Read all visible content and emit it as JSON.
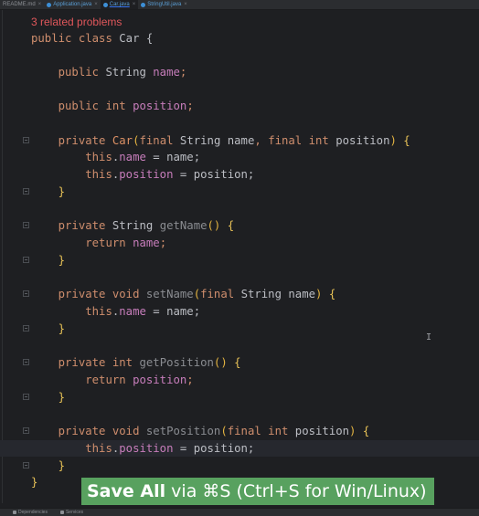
{
  "tabs": [
    {
      "label": "README.md",
      "icon": "markdown-icon",
      "active": false
    },
    {
      "label": "Application.java",
      "icon": "java-class-icon",
      "active": false
    },
    {
      "label": "Car.java",
      "icon": "java-class-icon",
      "active": true
    },
    {
      "label": "StringUtil.java",
      "icon": "java-class-icon",
      "active": false
    }
  ],
  "tab_close_glyph": "×",
  "editor": {
    "problems_hint": "3 related problems",
    "code": {
      "l1_kw1": "public",
      "l1_kw2": "class",
      "l1_name": "Car",
      "l1_brace": "{",
      "name_field": {
        "kw": "public",
        "type": "String",
        "name": "name",
        "semi": ";"
      },
      "pos_field": {
        "kw1": "public",
        "kw2": "int",
        "name": "position",
        "semi": ";"
      },
      "ctor": {
        "kw": "private",
        "name": "Car",
        "open": "(",
        "p1kw": "final",
        "p1type": "String",
        "p1name": "name",
        "comma": ",",
        "p2kw": "final",
        "p2type": "int",
        "p2name": "position",
        "close": ")",
        "brace": "{"
      },
      "ctor_b1": {
        "this": "this",
        "dot": ".",
        "field": "name",
        "rest": " = name;"
      },
      "ctor_b2": {
        "this": "this",
        "dot": ".",
        "field": "position",
        "rest": " = position;"
      },
      "close_brace": "}",
      "getName": {
        "kw": "private",
        "type": "String",
        "name": "getName",
        "parens": "()",
        "brace": "{"
      },
      "getName_body": {
        "kw": "return",
        "field": "name",
        "semi": ";"
      },
      "setName": {
        "kw1": "private",
        "kw2": "void",
        "name": "setName",
        "open": "(",
        "pkw": "final",
        "ptype": "String",
        "pname": "name",
        "close": ")",
        "brace": "{"
      },
      "setName_body": {
        "this": "this",
        "dot": ".",
        "field": "name",
        "rest": " = name;"
      },
      "getPosition": {
        "kw1": "private",
        "kw2": "int",
        "name": "getPosition",
        "parens": "()",
        "brace": "{"
      },
      "getPosition_body": {
        "kw": "return",
        "field": "position",
        "semi": ";"
      },
      "setPosition": {
        "kw1": "private",
        "kw2": "void",
        "name": "setPosition",
        "open": "(",
        "pkw": "final",
        "ptype": "int",
        "pname": "position",
        "close": ")",
        "brace": "{"
      },
      "setPosition_body": {
        "this": "this",
        "dot": ".",
        "field": "position",
        "rest": " = position;"
      },
      "class_close": "}"
    }
  },
  "toast": {
    "bold": "Save All",
    "rest": " via ⌘S (Ctrl+S for Win/Linux)"
  },
  "status": {
    "dependencies": "Dependencies",
    "services": "Services"
  },
  "cursor_glyph": "I"
}
